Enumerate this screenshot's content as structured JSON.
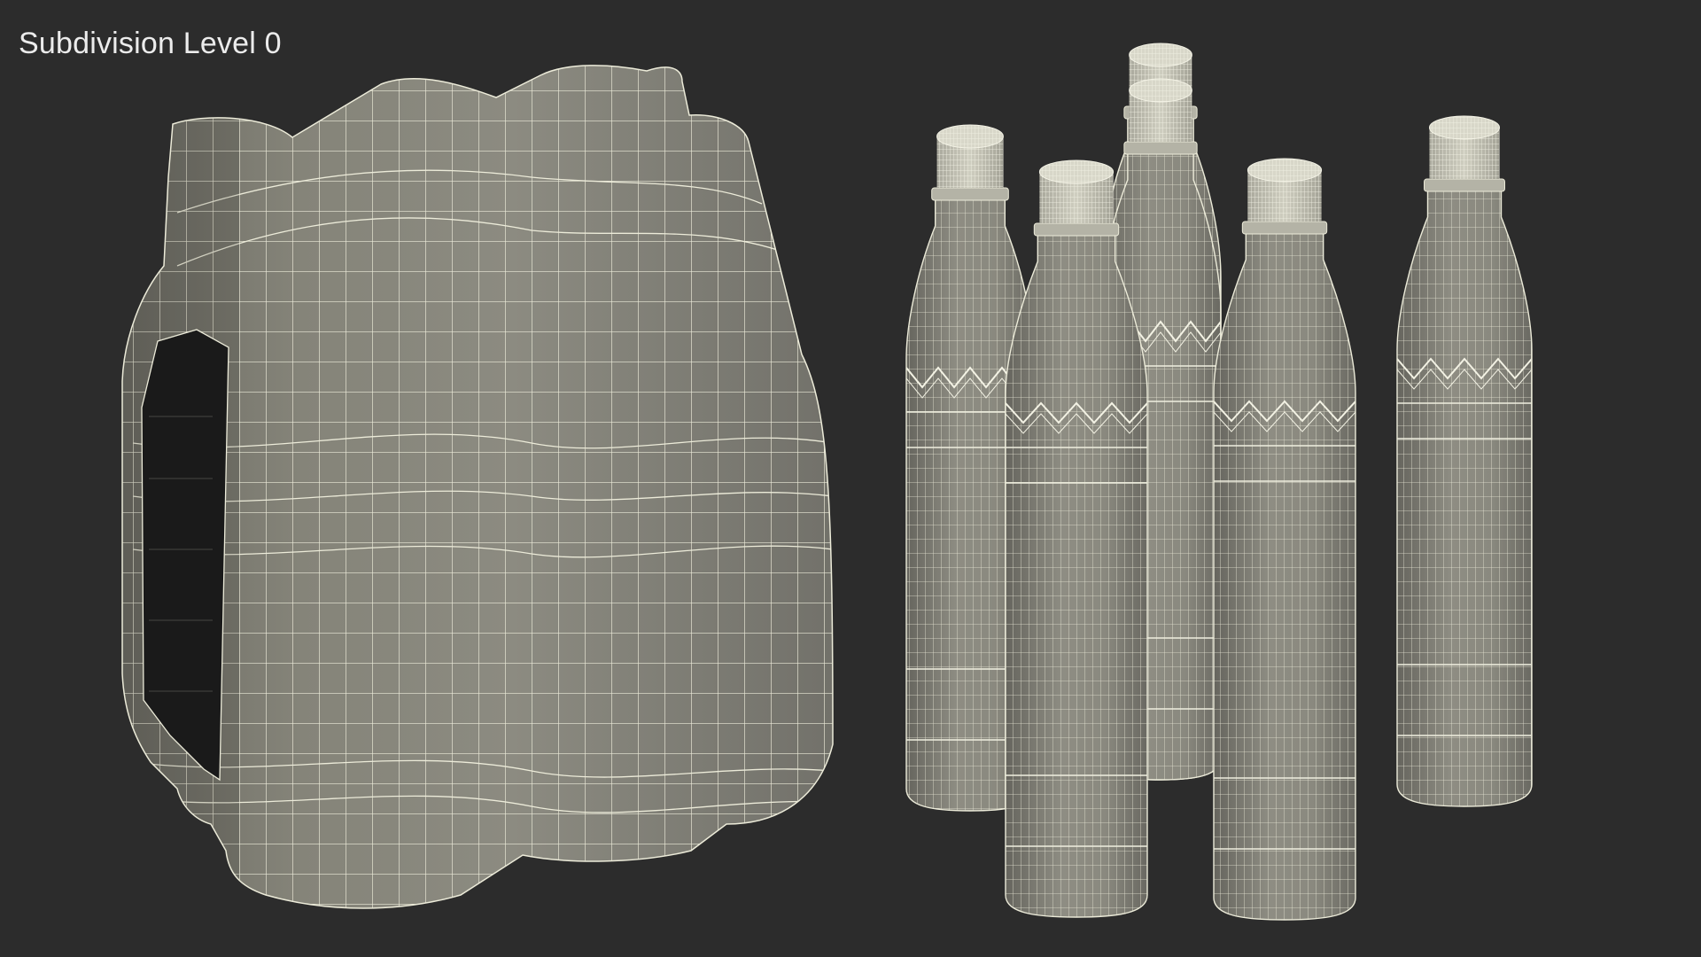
{
  "viewport": {
    "caption": "Subdivision Level 0",
    "background_color": "#2c2c2c"
  },
  "scene": {
    "mesh_fill_color": "#8b8a80",
    "wire_color": "#ecebd9",
    "objects": [
      {
        "name": "shrink-wrap-pack",
        "kind": "six-pack shrink wrap with handle"
      },
      {
        "name": "bottle",
        "count": 6
      }
    ]
  }
}
